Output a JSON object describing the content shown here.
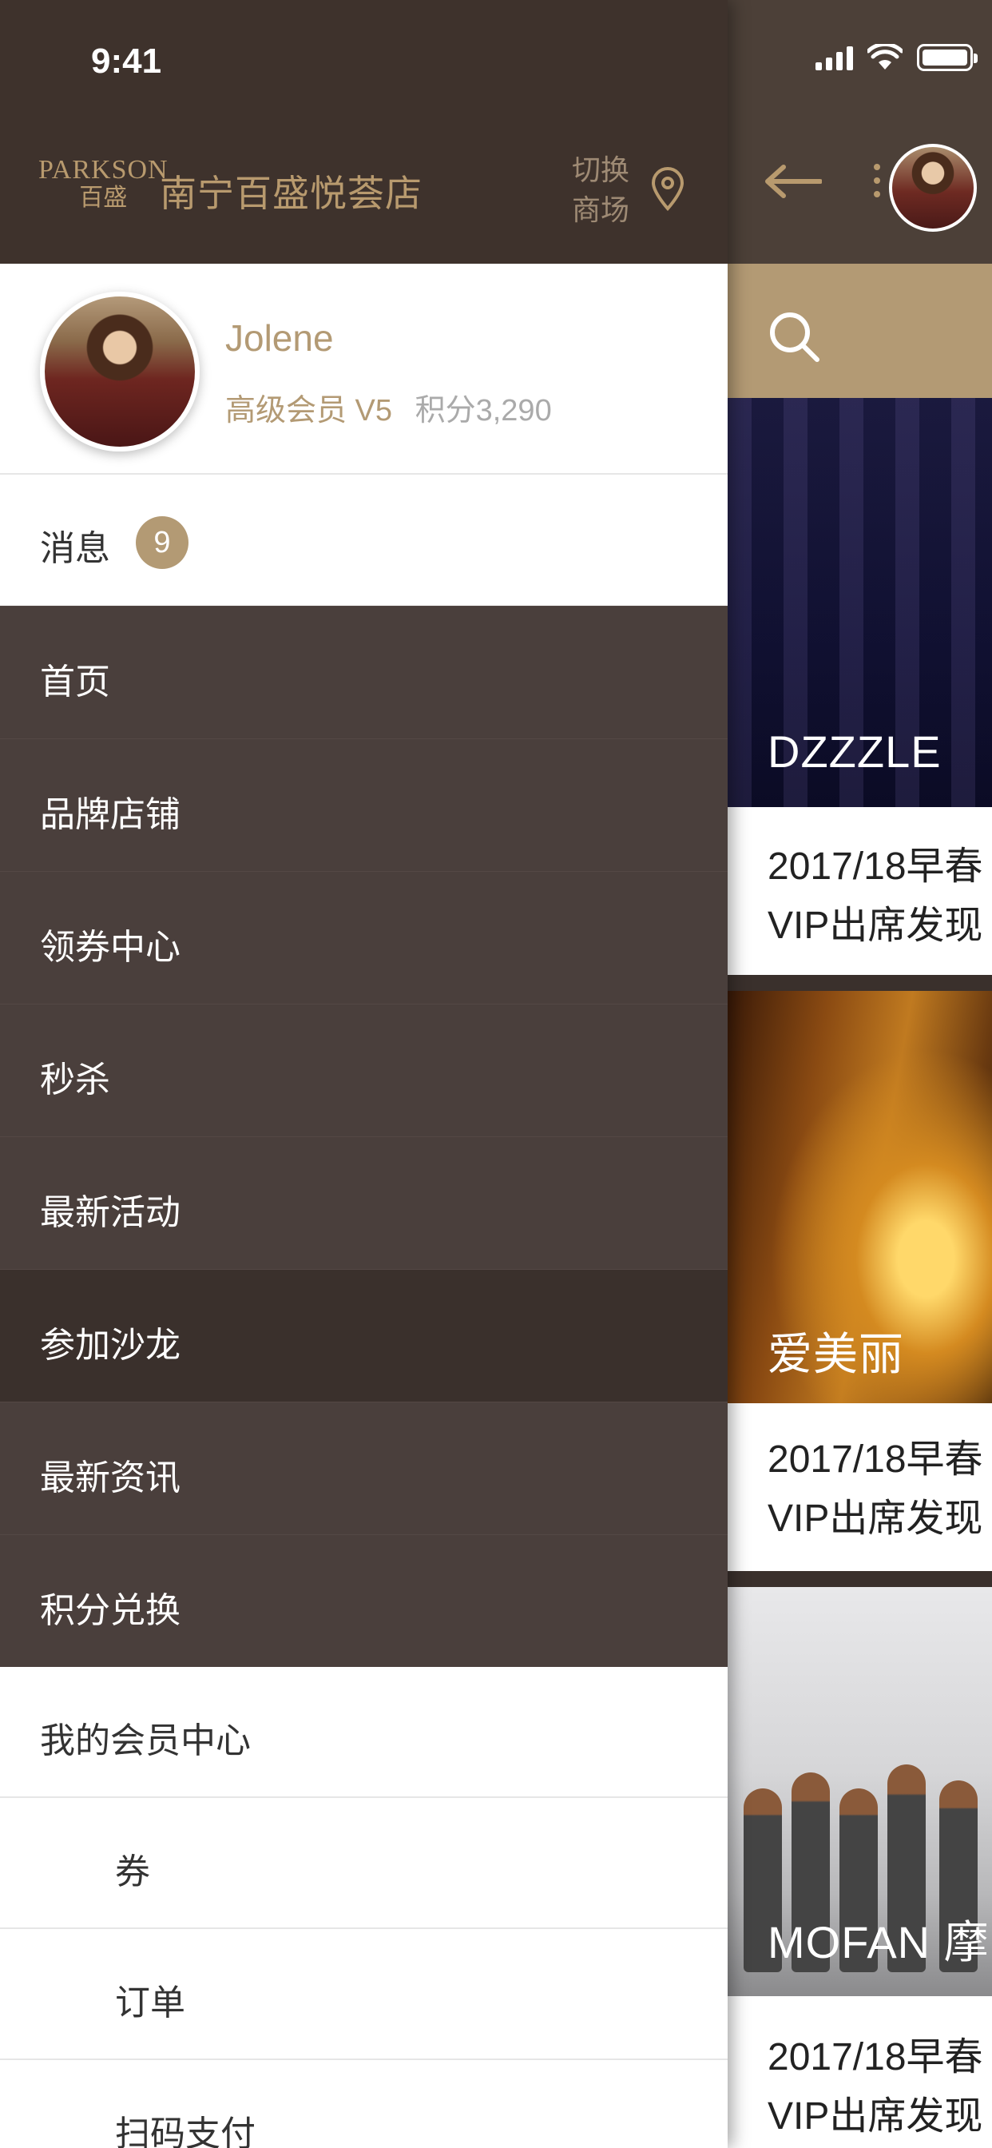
{
  "status_bar": {
    "time": "9:41"
  },
  "drawer": {
    "header": {
      "logo_en": "PARKSON",
      "logo_cn": "百盛",
      "store_name": "南宁百盛悦荟店",
      "switch_line1": "切换",
      "switch_line2": "商场"
    },
    "profile": {
      "name": "Jolene",
      "level": "高级会员 V5",
      "points": "积分3,290"
    },
    "messages": {
      "label": "消息",
      "count": "9"
    },
    "menu": [
      {
        "label": "首页"
      },
      {
        "label": "品牌店铺"
      },
      {
        "label": "领券中心"
      },
      {
        "label": "秒杀"
      },
      {
        "label": "最新活动"
      },
      {
        "label": "参加沙龙"
      },
      {
        "label": "最新资讯"
      },
      {
        "label": "积分兑换"
      }
    ],
    "active_menu": "参加沙龙",
    "account": {
      "title": "我的会员中心",
      "items": [
        {
          "label": "券"
        },
        {
          "label": "订单"
        },
        {
          "label": "扫码支付"
        }
      ]
    }
  },
  "content": {
    "cards": [
      {
        "title": "DZZZLE",
        "desc_line1": "2017/18早春",
        "desc_line2": "VIP出席发现"
      },
      {
        "title": "爱美丽",
        "desc_line1": "2017/18早春",
        "desc_line2": "VIP出席发现"
      },
      {
        "title": "MOFAN 摩",
        "desc_line1": "2017/18早春",
        "desc_line2": "VIP出席发现"
      }
    ]
  },
  "colors": {
    "gold": "#b39a74",
    "header_dark": "#3e322c",
    "menu_bg": "#4a3f3c",
    "menu_active": "#3a302c"
  },
  "icons": [
    "location-pin-icon",
    "search-icon",
    "back-arrow-icon",
    "more-icon",
    "signal-icon",
    "wifi-icon",
    "battery-icon"
  ]
}
